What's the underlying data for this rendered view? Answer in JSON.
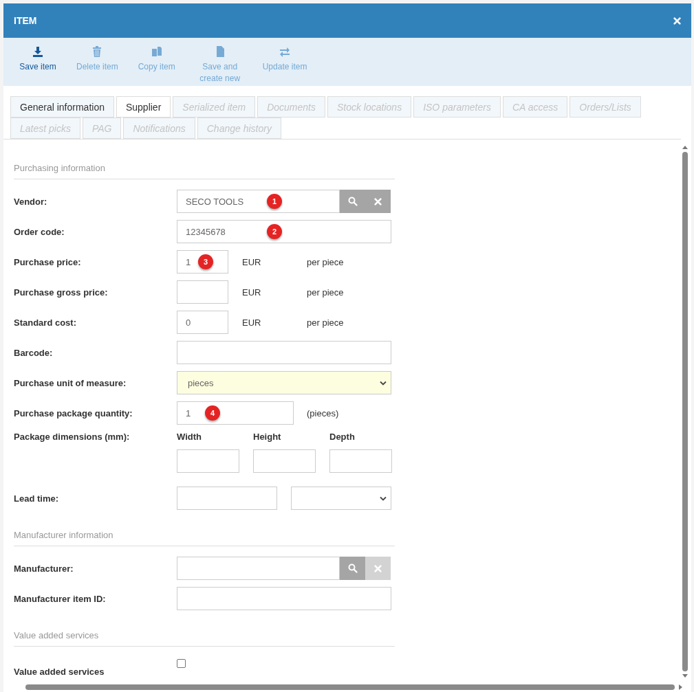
{
  "window": {
    "title": "ITEM"
  },
  "toolbar": [
    {
      "kind": "save",
      "label": "Save item",
      "disabled": false
    },
    {
      "kind": "delete",
      "label": "Delete item",
      "disabled": true
    },
    {
      "kind": "copy",
      "label": "Copy item",
      "disabled": true
    },
    {
      "kind": "new",
      "label": "Save and create new",
      "disabled": true
    },
    {
      "kind": "update",
      "label": "Update item",
      "disabled": true
    }
  ],
  "tabs": [
    {
      "label": "General information",
      "selected": false,
      "disabled": false
    },
    {
      "label": "Supplier",
      "selected": true,
      "disabled": false
    },
    {
      "label": "Serialized item",
      "selected": false,
      "disabled": true
    },
    {
      "label": "Documents",
      "selected": false,
      "disabled": true
    },
    {
      "label": "Stock locations",
      "selected": false,
      "disabled": true
    },
    {
      "label": "ISO parameters",
      "selected": false,
      "disabled": true
    },
    {
      "label": "CA access",
      "selected": false,
      "disabled": true
    },
    {
      "label": "Orders/Lists",
      "selected": false,
      "disabled": true
    },
    {
      "label": "Latest picks",
      "selected": false,
      "disabled": true
    },
    {
      "label": "PAG",
      "selected": false,
      "disabled": true
    },
    {
      "label": "Notifications",
      "selected": false,
      "disabled": true
    },
    {
      "label": "Change history",
      "selected": false,
      "disabled": true
    }
  ],
  "form": [
    {
      "kind": "section",
      "label": "Purchasing information"
    },
    {
      "kind": "lookup",
      "label": "Vendor:",
      "value": "SECO TOOLS",
      "marker": "1",
      "clear_disabled": false
    },
    {
      "kind": "text",
      "label": "Order code:",
      "value": "12345678",
      "marker": "2"
    },
    {
      "kind": "price",
      "label": "Purchase price:",
      "value": "1",
      "marker": "3",
      "currency": "EUR",
      "unit": "per piece"
    },
    {
      "kind": "price",
      "label": "Purchase gross price:",
      "currency": "EUR",
      "unit": "per piece"
    },
    {
      "kind": "price",
      "label": "Standard cost:",
      "value": "0",
      "currency": "EUR",
      "unit": "per piece"
    },
    {
      "kind": "text",
      "label": "Barcode:"
    },
    {
      "kind": "select",
      "label": "Purchase unit of measure:",
      "value": "pieces"
    },
    {
      "kind": "qty",
      "label": "Purchase package quantity:",
      "value": "1",
      "marker": "4",
      "unit": "(pieces)"
    },
    {
      "kind": "dims",
      "label": "Package dimensions (mm):",
      "columns": [
        "Width",
        "Height",
        "Depth"
      ]
    },
    {
      "kind": "leadtime",
      "label": "Lead time:"
    },
    {
      "kind": "section",
      "label": "Manufacturer information"
    },
    {
      "kind": "lookup",
      "label": "Manufacturer:",
      "clear_disabled": true
    },
    {
      "kind": "text",
      "label": "Manufacturer item ID:"
    },
    {
      "kind": "section",
      "label": "Value added services"
    },
    {
      "kind": "checkbox",
      "label": "Value added services",
      "checked": false
    }
  ]
}
